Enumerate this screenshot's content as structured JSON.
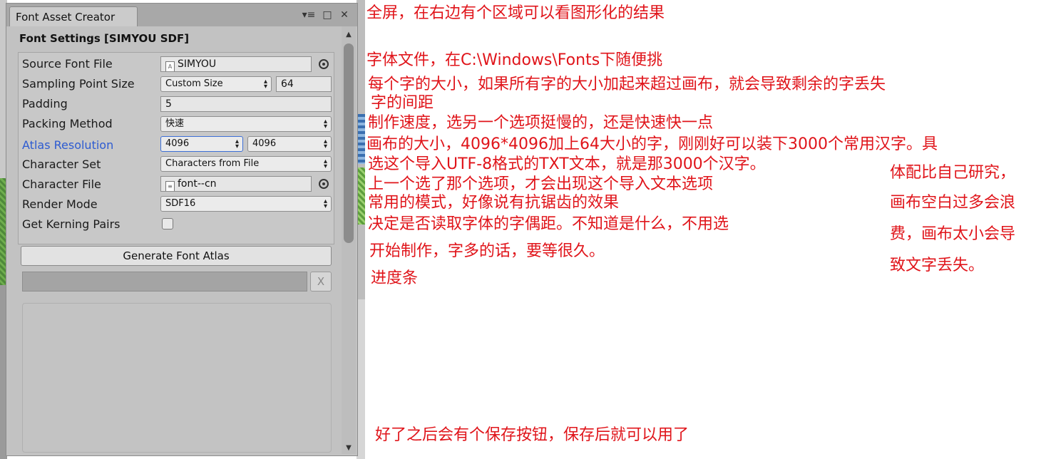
{
  "window": {
    "tab_title": "Font Asset Creator",
    "tab_controls": {
      "menu": "▾≡",
      "maximize": "□",
      "close": "✕"
    }
  },
  "section_title": "Font Settings [SIMYOU SDF]",
  "settings": {
    "source_font_file": {
      "label": "Source Font File",
      "value": "SIMYOU"
    },
    "sampling_point_size": {
      "label": "Sampling Point Size",
      "mode": "Custom Size",
      "value": "64"
    },
    "padding": {
      "label": "Padding",
      "value": "5"
    },
    "packing_method": {
      "label": "Packing Method",
      "value": "快速"
    },
    "atlas_resolution": {
      "label": "Atlas Resolution",
      "width": "4096",
      "height": "4096"
    },
    "character_set": {
      "label": "Character Set",
      "value": "Characters from File"
    },
    "character_file": {
      "label": "Character File",
      "value": "font--cn"
    },
    "render_mode": {
      "label": "Render Mode",
      "value": "SDF16"
    },
    "get_kerning_pairs": {
      "label": "Get Kerning Pairs",
      "checked": false
    }
  },
  "generate_button": "Generate Font Atlas",
  "progress": {
    "fraction": 0.0,
    "cancel": "X"
  },
  "annotations": {
    "fullscreen": "全屏，在右边有个区域可以看图形化的结果",
    "font_file": "字体文件，在C:\\Windows\\Fonts下随便挑",
    "point_size": "每个字的大小，如果所有字的大小加起来超过画布，就会导致剩余的字丢失",
    "padding": "字的间距",
    "packing": "制作速度，选另一个选项挺慢的，还是快速快一点",
    "atlas": "画布的大小，4096*4096加上64大小的字，刚刚好可以装下3000个常用汉字。具",
    "charset": "选这个导入UTF-8格式的TXT文本，就是那3000个汉字。",
    "charfile": "上一个选了那个选项，才会出现这个导入文本选项",
    "render": "常用的模式，好像说有抗锯齿的效果",
    "kerning": "决定是否读取字体的字偶距。不知道是什么，不用选",
    "generate": "开始制作，字多的话，要等很久。",
    "progress": "进度条",
    "side_1": "体配比自己研究，",
    "side_2": "画布空白过多会浪",
    "side_3": "费，画布太小会导",
    "side_4": "致文字丢失。",
    "save": "好了之后会有个保存按钮，保存后就可以用了"
  }
}
